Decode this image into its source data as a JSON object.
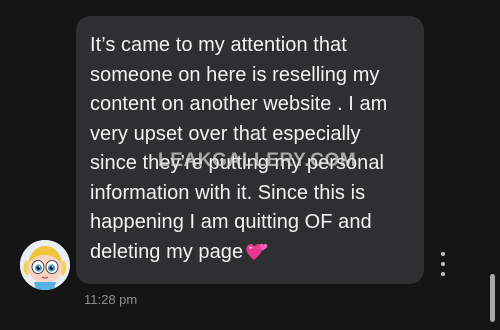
{
  "message": {
    "lines": [
      "It’s came to my attention that",
      "someone on here is reselling my",
      "content on another website . I am",
      "very upset over that especially",
      "since they’re putting my personal",
      "information with it. Since this is",
      "happening I am quitting OF and",
      "deleting my page"
    ],
    "emoji": "revolving-hearts-emoji",
    "timestamp": "11:28 pm"
  },
  "watermark": "LEAKGALLERY.COM",
  "colors": {
    "background": "#141414",
    "bubble": "#2f2f31",
    "text": "#f2f2f2",
    "timestamp": "#8e8e8e",
    "heart": "#e8358f"
  },
  "icons": {
    "avatar": "cartoon-girl-avatar",
    "more": "more-vertical-icon"
  }
}
